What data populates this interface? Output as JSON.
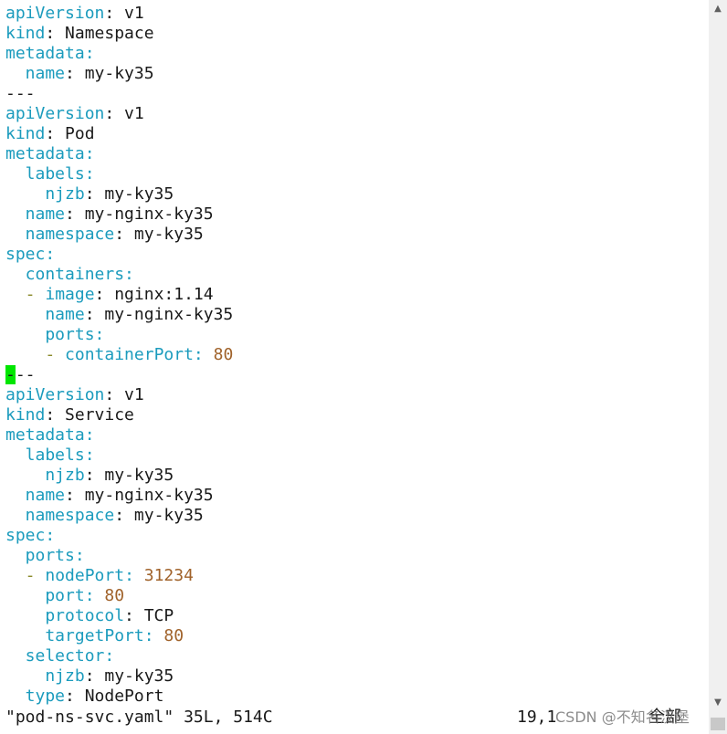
{
  "editor": {
    "lines": [
      [
        {
          "t": "apiVersion",
          "c": "k"
        },
        {
          "t": ": v1",
          "c": "p"
        }
      ],
      [
        {
          "t": "kind",
          "c": "k"
        },
        {
          "t": ": Namespace",
          "c": "p"
        }
      ],
      [
        {
          "t": "metadata",
          "c": "k"
        },
        {
          "t": ":",
          "c": "k"
        }
      ],
      [
        {
          "t": "  name",
          "c": "k"
        },
        {
          "t": ": my-ky35",
          "c": "p"
        }
      ],
      [
        {
          "t": "---",
          "c": "p"
        }
      ],
      [
        {
          "t": "apiVersion",
          "c": "k"
        },
        {
          "t": ": v1",
          "c": "p"
        }
      ],
      [
        {
          "t": "kind",
          "c": "k"
        },
        {
          "t": ": Pod",
          "c": "p"
        }
      ],
      [
        {
          "t": "metadata",
          "c": "k"
        },
        {
          "t": ":",
          "c": "k"
        }
      ],
      [
        {
          "t": "  labels",
          "c": "k"
        },
        {
          "t": ":",
          "c": "k"
        }
      ],
      [
        {
          "t": "    njzb",
          "c": "k"
        },
        {
          "t": ": my-ky35",
          "c": "p"
        }
      ],
      [
        {
          "t": "  name",
          "c": "k"
        },
        {
          "t": ": my-nginx-ky35",
          "c": "p"
        }
      ],
      [
        {
          "t": "  namespace",
          "c": "k"
        },
        {
          "t": ": my-ky35",
          "c": "p"
        }
      ],
      [
        {
          "t": "spec",
          "c": "k"
        },
        {
          "t": ":",
          "c": "k"
        }
      ],
      [
        {
          "t": "  containers",
          "c": "k"
        },
        {
          "t": ":",
          "c": "k"
        }
      ],
      [
        {
          "t": "  - ",
          "c": "d"
        },
        {
          "t": "image",
          "c": "k"
        },
        {
          "t": ": nginx:1.14",
          "c": "p"
        }
      ],
      [
        {
          "t": "    name",
          "c": "k"
        },
        {
          "t": ": my-nginx-ky35",
          "c": "p"
        }
      ],
      [
        {
          "t": "    ports",
          "c": "k"
        },
        {
          "t": ":",
          "c": "k"
        }
      ],
      [
        {
          "t": "    - ",
          "c": "d"
        },
        {
          "t": "containerPort",
          "c": "k"
        },
        {
          "t": ": ",
          "c": "k"
        },
        {
          "t": "80",
          "c": "n"
        }
      ],
      [
        {
          "t": "-",
          "c": "cursor"
        },
        {
          "t": "--",
          "c": "p"
        }
      ],
      [
        {
          "t": "apiVersion",
          "c": "k"
        },
        {
          "t": ": v1",
          "c": "p"
        }
      ],
      [
        {
          "t": "kind",
          "c": "k"
        },
        {
          "t": ": Service",
          "c": "p"
        }
      ],
      [
        {
          "t": "metadata",
          "c": "k"
        },
        {
          "t": ":",
          "c": "k"
        }
      ],
      [
        {
          "t": "  labels",
          "c": "k"
        },
        {
          "t": ":",
          "c": "k"
        }
      ],
      [
        {
          "t": "    njzb",
          "c": "k"
        },
        {
          "t": ": my-ky35",
          "c": "p"
        }
      ],
      [
        {
          "t": "  name",
          "c": "k"
        },
        {
          "t": ": my-nginx-ky35",
          "c": "p"
        }
      ],
      [
        {
          "t": "  namespace",
          "c": "k"
        },
        {
          "t": ": my-ky35",
          "c": "p"
        }
      ],
      [
        {
          "t": "spec",
          "c": "k"
        },
        {
          "t": ":",
          "c": "k"
        }
      ],
      [
        {
          "t": "  ports",
          "c": "k"
        },
        {
          "t": ":",
          "c": "k"
        }
      ],
      [
        {
          "t": "  - ",
          "c": "d"
        },
        {
          "t": "nodePort",
          "c": "k"
        },
        {
          "t": ": ",
          "c": "k"
        },
        {
          "t": "31234",
          "c": "n"
        }
      ],
      [
        {
          "t": "    port",
          "c": "k"
        },
        {
          "t": ": ",
          "c": "k"
        },
        {
          "t": "80",
          "c": "n"
        }
      ],
      [
        {
          "t": "    protocol",
          "c": "k"
        },
        {
          "t": ": TCP",
          "c": "p"
        }
      ],
      [
        {
          "t": "    targetPort",
          "c": "k"
        },
        {
          "t": ": ",
          "c": "k"
        },
        {
          "t": "80",
          "c": "n"
        }
      ],
      [
        {
          "t": "  selector",
          "c": "k"
        },
        {
          "t": ":",
          "c": "k"
        }
      ],
      [
        {
          "t": "    njzb",
          "c": "k"
        },
        {
          "t": ": my-ky35",
          "c": "p"
        }
      ],
      [
        {
          "t": "  type",
          "c": "k"
        },
        {
          "t": ": NodePort",
          "c": "p"
        }
      ]
    ]
  },
  "status": {
    "file_info": "\"pod-ns-svc.yaml\" 35L, 514C",
    "position": "19,1",
    "scroll_indicator": "全部"
  },
  "watermark": "CSDN @不知名汉堡",
  "colors": {
    "key": "#1b9bbd",
    "dash": "#8a8a2a",
    "number": "#a0622a",
    "text": "#1a1a1a",
    "cursor": "#00e600"
  },
  "icons": {
    "scroll_up": "scroll-up-arrow-icon",
    "scroll_down": "scroll-down-arrow-icon"
  }
}
